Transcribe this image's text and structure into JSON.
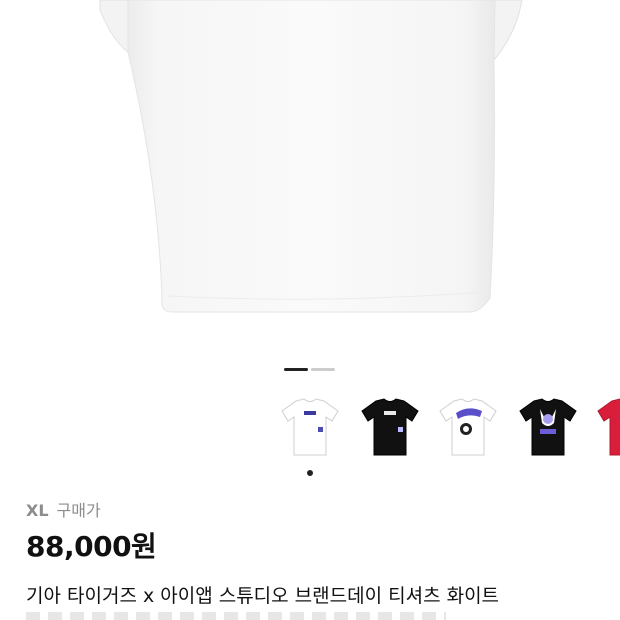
{
  "colors": {
    "pager_active": "#222222",
    "pager_inactive": "#cccccc",
    "accent_thumb_red": "#d81e3a"
  },
  "gallery": {
    "pager": {
      "active_index": 0,
      "count": 2
    },
    "thumbnails": [
      {
        "name": "white-tee-thumbnail",
        "color": "#ffffff",
        "print": "small-logo"
      },
      {
        "name": "black-tee-thumbnail",
        "color": "#111111",
        "print": "small-logo"
      },
      {
        "name": "white-graphic-tee-thumbnail",
        "color": "#ffffff",
        "print": "graphic"
      },
      {
        "name": "black-graphic-tee-thumbnail",
        "color": "#111111",
        "print": "graphic"
      },
      {
        "name": "red-tee-thumbnail",
        "color": "#d81e3a",
        "print": "none"
      }
    ],
    "selected_thumbnail": 0
  },
  "product": {
    "size": "XL",
    "purchase_price_label": "구매가",
    "price": "88,000원",
    "title": "기아 타이거즈 x 아이앱 스튜디오 브랜드데이 티셔츠 화이트"
  }
}
